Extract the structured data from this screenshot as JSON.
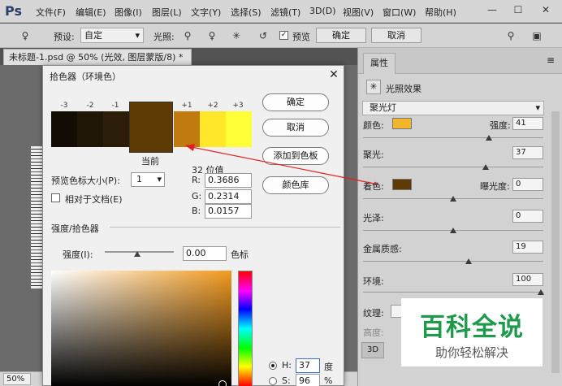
{
  "app_logo": "Ps",
  "menu": [
    "文件(F)",
    "编辑(E)",
    "图像(I)",
    "图层(L)",
    "文字(Y)",
    "选择(S)",
    "滤镜(T)",
    "3D(D)",
    "视图(V)",
    "窗口(W)",
    "帮助(H)"
  ],
  "window_controls": {
    "minimize": "—",
    "maximize": "☐",
    "close": "✕"
  },
  "options": {
    "preset_label": "预设:",
    "preset_value": "自定",
    "light_label": "光照:",
    "preview_label": "预览",
    "ok": "确定",
    "cancel": "取消"
  },
  "document_tab": "未标题-1.psd @ 50% (光效, 图层蒙版/8) *",
  "status_zoom": "50%",
  "picker": {
    "title": "拾色器（环境色）",
    "offset_labels": [
      "-3",
      "-2",
      "-1",
      "+1",
      "+2",
      "+3"
    ],
    "swatch_colors": [
      "#120c04",
      "#1f1608",
      "#2c1d09",
      "#5e3b04",
      "#c07a0f",
      "#ffe82a",
      "#ffff38"
    ],
    "current_label": "当前",
    "ok": "确定",
    "cancel": "取消",
    "add_to_swatches": "添加到色板",
    "color_libraries": "颜色库",
    "preview_size_label": "预览色标大小(P):",
    "preview_size_value": "1",
    "relative_label": "相对于文档(E)",
    "bit_label": "32 位值",
    "r_label": "R:",
    "r_value": "0.3686",
    "g_label": "G:",
    "g_value": "0.2314",
    "b_label": "B:",
    "b_value": "0.0157",
    "section_label": "强度/拾色器",
    "intensity_label": "强度(I):",
    "intensity_value": "0.00",
    "intensity_unit": "色标",
    "h_label": "H:",
    "h_value": "37",
    "h_unit": "度",
    "s_label": "S:",
    "s_value": "96",
    "s_unit": "%"
  },
  "properties": {
    "tab": "属性",
    "header": "光照效果",
    "preset": "聚光灯",
    "color_label": "颜色:",
    "color_swatch": "#f2b62a",
    "intensity_label": "强度:",
    "intensity_value": "41",
    "hotspot_label": "聚光:",
    "hotspot_value": "37",
    "colorize_label": "着色:",
    "colorize_swatch": "#5e3b04",
    "exposure_label": "曝光度:",
    "exposure_value": "0",
    "gloss_label": "光泽:",
    "gloss_value": "0",
    "metallic_label": "金属质感:",
    "metallic_value": "19",
    "ambience_label": "环境:",
    "ambience_value": "100",
    "texture_label": "纹理:",
    "height_label": "高度:",
    "bottom_tab": "3D"
  },
  "watermark": {
    "title": "百科全说",
    "subtitle": "助你轻松解决"
  }
}
